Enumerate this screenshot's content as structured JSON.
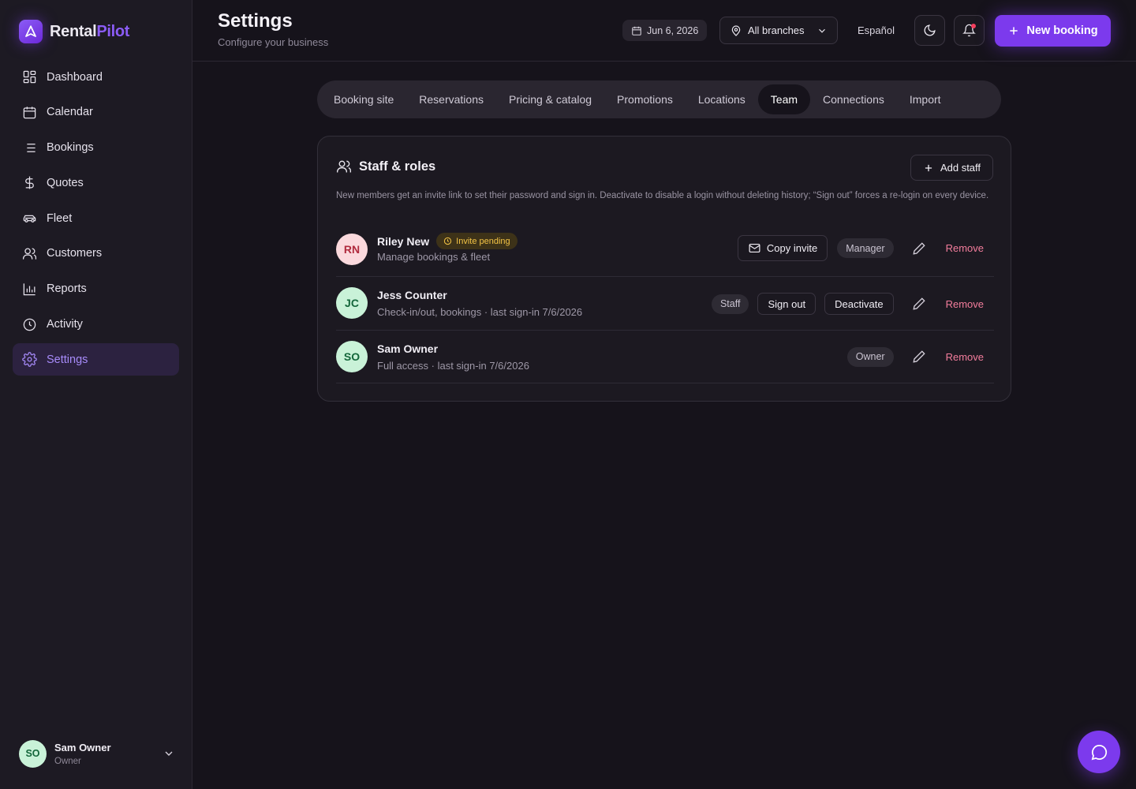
{
  "brand": {
    "name_part1": "Rental",
    "name_part2": "Pilot",
    "logo_icon": "logo-icon"
  },
  "sidebar": {
    "items": [
      {
        "label": "Dashboard",
        "icon": "dashboard-icon"
      },
      {
        "label": "Calendar",
        "icon": "calendar-icon"
      },
      {
        "label": "Bookings",
        "icon": "list-icon"
      },
      {
        "label": "Quotes",
        "icon": "dollar-icon"
      },
      {
        "label": "Fleet",
        "icon": "car-icon"
      },
      {
        "label": "Customers",
        "icon": "users-icon"
      },
      {
        "label": "Reports",
        "icon": "bar-chart-icon"
      },
      {
        "label": "Activity",
        "icon": "clock-icon"
      },
      {
        "label": "Settings",
        "icon": "gear-icon",
        "active": true
      }
    ],
    "user": {
      "initials": "SO",
      "name": "Sam Owner",
      "role": "Owner"
    }
  },
  "header": {
    "title": "Settings",
    "subtitle": "Configure your business",
    "date": "Jun 6, 2026",
    "branch": "All branches",
    "language": "Español",
    "new_booking": "New booking"
  },
  "tabs": [
    {
      "label": "Booking site"
    },
    {
      "label": "Reservations"
    },
    {
      "label": "Pricing & catalog"
    },
    {
      "label": "Promotions"
    },
    {
      "label": "Locations"
    },
    {
      "label": "Team",
      "active": true
    },
    {
      "label": "Connections"
    },
    {
      "label": "Import"
    }
  ],
  "team": {
    "title": "Staff & roles",
    "add_staff": "Add staff",
    "description": "New members get an invite link to set their password and sign in. Deactivate to disable a login without deleting history; “Sign out” forces a re-login on every device.",
    "remove_label": "Remove",
    "members": [
      {
        "initials": "RN",
        "name": "Riley New",
        "badge": "Invite pending",
        "desc": "Manage bookings & fleet",
        "role": "Manager",
        "copy_invite": "Copy invite"
      },
      {
        "initials": "JC",
        "name": "Jess Counter",
        "desc": "Check-in/out, bookings · last sign-in 7/6/2026",
        "role": "Staff",
        "sign_out": "Sign out",
        "deactivate": "Deactivate"
      },
      {
        "initials": "SO",
        "name": "Sam Owner",
        "desc": "Full access · last sign-in 7/6/2026",
        "role": "Owner"
      }
    ]
  },
  "colors": {
    "accent": "#7c3aed",
    "background": "#16131b",
    "sidebar": "#1d1a23",
    "remove": "#f37d9c",
    "pending": "#f3c345"
  }
}
